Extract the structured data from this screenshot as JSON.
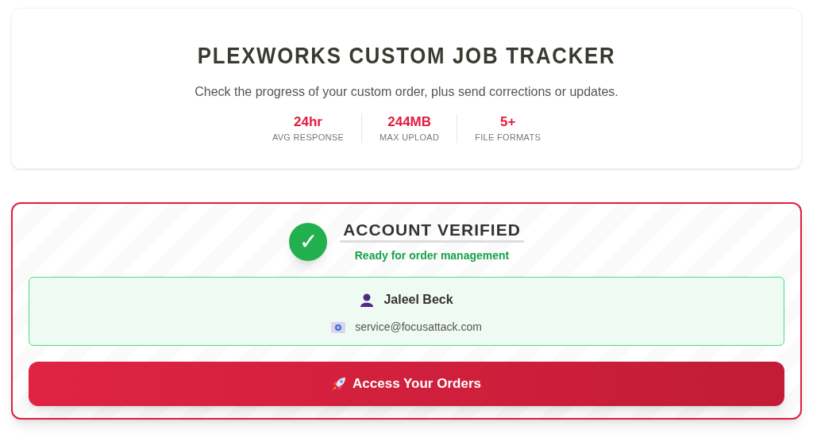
{
  "header": {
    "title": "PLEXWORKS CUSTOM JOB TRACKER",
    "subtitle": "Check the progress of your custom order, plus send corrections or updates.",
    "stats": [
      {
        "value": "24hr",
        "label": "AVG RESPONSE"
      },
      {
        "value": "244MB",
        "label": "MAX UPLOAD"
      },
      {
        "value": "5+",
        "label": "FILE FORMATS"
      }
    ]
  },
  "verification": {
    "badge": "✓",
    "title": "ACCOUNT VERIFIED",
    "status": "Ready for order management"
  },
  "account": {
    "name": "Jaleel Beck",
    "email": "service@focusattack.com"
  },
  "button": {
    "label": "Access Your Orders"
  }
}
